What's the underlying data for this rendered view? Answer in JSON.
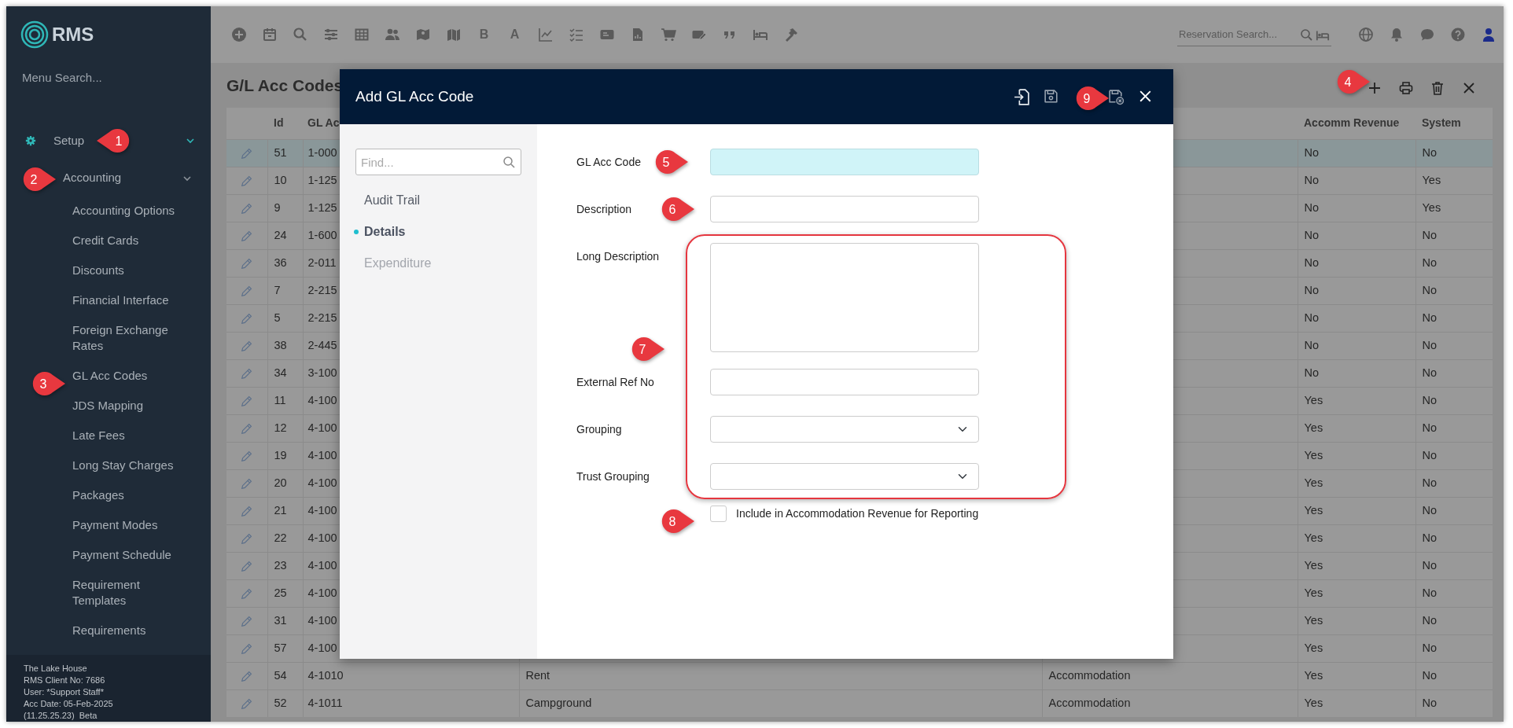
{
  "sidebar": {
    "logo": "RMS",
    "search": {
      "placeholder": "Menu Search..."
    },
    "menu": [
      {
        "label": "Setup",
        "expanded": true,
        "children": [
          {
            "label": "Accounting",
            "expanded": true,
            "children": [
              {
                "label": "Accounting Options"
              },
              {
                "label": "Credit Cards"
              },
              {
                "label": "Discounts"
              },
              {
                "label": "Financial Interface"
              },
              {
                "label": "Foreign Exchange Rates"
              },
              {
                "label": "GL Acc Codes"
              },
              {
                "label": "JDS Mapping"
              },
              {
                "label": "Late Fees"
              },
              {
                "label": "Long Stay Charges"
              },
              {
                "label": "Packages"
              },
              {
                "label": "Payment Modes"
              },
              {
                "label": "Payment Schedule"
              },
              {
                "label": "Requirement Templates"
              },
              {
                "label": "Requirements"
              }
            ]
          }
        ]
      }
    ],
    "footer": [
      "The Lake House",
      "RMS Client No: 7686",
      "User: *Support Staff*",
      "Acc Date: 05-Feb-2025",
      "(11.25.25.23)  Beta"
    ]
  },
  "top_bar": {
    "text_buttons": [
      "B",
      "A"
    ],
    "search": {
      "placeholder": "Reservation Search..."
    }
  },
  "page": {
    "title": "G/L Acc Codes"
  },
  "table": {
    "columns": {
      "id": "Id",
      "code": "GL Ac",
      "accomm_revenue": "Accomm Revenue",
      "system": "System"
    },
    "rows": [
      {
        "id": "51",
        "code": "1-000",
        "accomm_revenue": "No",
        "system": "No",
        "selected": true
      },
      {
        "id": "10",
        "code": "1-125",
        "accomm_revenue": "No",
        "system": "Yes",
        "selected": false
      },
      {
        "id": "9",
        "code": "1-125",
        "accomm_revenue": "No",
        "system": "Yes",
        "selected": false
      },
      {
        "id": "24",
        "code": "1-600",
        "accomm_revenue": "No",
        "system": "No",
        "selected": false
      },
      {
        "id": "36",
        "code": "2-011",
        "accomm_revenue": "No",
        "system": "No",
        "selected": false
      },
      {
        "id": "7",
        "code": "2-215",
        "accomm_revenue": "No",
        "system": "No",
        "selected": false
      },
      {
        "id": "5",
        "code": "2-215",
        "accomm_revenue": "No",
        "system": "No",
        "selected": false
      },
      {
        "id": "38",
        "code": "2-445",
        "accomm_revenue": "No",
        "system": "No",
        "selected": false
      },
      {
        "id": "34",
        "code": "3-100",
        "accomm_revenue": "No",
        "system": "No",
        "selected": false
      },
      {
        "id": "11",
        "code": "4-100",
        "accomm_revenue": "Yes",
        "system": "No",
        "selected": false
      },
      {
        "id": "12",
        "code": "4-100",
        "accomm_revenue": "Yes",
        "system": "No",
        "selected": false
      },
      {
        "id": "19",
        "code": "4-100",
        "accomm_revenue": "Yes",
        "system": "No",
        "selected": false
      },
      {
        "id": "20",
        "code": "4-100",
        "accomm_revenue": "Yes",
        "system": "No",
        "selected": false
      },
      {
        "id": "21",
        "code": "4-100",
        "accomm_revenue": "Yes",
        "system": "No",
        "selected": false
      },
      {
        "id": "22",
        "code": "4-100",
        "accomm_revenue": "Yes",
        "system": "No",
        "selected": false
      },
      {
        "id": "23",
        "code": "4-100",
        "accomm_revenue": "Yes",
        "system": "No",
        "selected": false
      },
      {
        "id": "25",
        "code": "4-100",
        "accomm_revenue": "Yes",
        "system": "No",
        "selected": false
      },
      {
        "id": "31",
        "code": "4-100",
        "accomm_revenue": "Yes",
        "system": "No",
        "selected": false
      },
      {
        "id": "57",
        "code": "4-100",
        "accomm_revenue": "Yes",
        "system": "No",
        "selected": false
      },
      {
        "id": "54",
        "code": "4-1010",
        "description": "Rent",
        "category": "Accommodation",
        "accomm_revenue": "Yes",
        "system": "No",
        "selected": false
      },
      {
        "id": "52",
        "code": "4-1011",
        "description": "Campground",
        "category": "Accommodation",
        "accomm_revenue": "Yes",
        "system": "No",
        "selected": false
      }
    ]
  },
  "modal": {
    "title": "Add GL Acc Code",
    "find": {
      "placeholder": "Find..."
    },
    "nav": [
      {
        "label": "Audit Trail",
        "selected": false,
        "disabled": false
      },
      {
        "label": "Details",
        "selected": true,
        "disabled": false
      },
      {
        "label": "Expenditure",
        "selected": false,
        "disabled": true
      }
    ],
    "fields": [
      {
        "kind": "text",
        "label": "GL Acc Code",
        "required": true
      },
      {
        "kind": "text",
        "label": "Description",
        "required": false
      },
      {
        "kind": "textarea",
        "label": "Long Description",
        "required": false
      },
      {
        "kind": "text",
        "label": "External Ref No",
        "required": false
      },
      {
        "kind": "select",
        "label": "Grouping",
        "required": false
      },
      {
        "kind": "select",
        "label": "Trust Grouping",
        "required": false
      },
      {
        "kind": "checkbox",
        "label": "Include in Accommodation Revenue for Reporting",
        "checked": false
      }
    ]
  },
  "annotations": {
    "highlight_frame": true,
    "callouts": [
      {
        "number": "1",
        "kind": "left"
      },
      {
        "number": "2",
        "kind": "right"
      },
      {
        "number": "3",
        "kind": "right"
      },
      {
        "number": "4",
        "kind": "right"
      },
      {
        "number": "5",
        "kind": "right"
      },
      {
        "number": "6",
        "kind": "right"
      },
      {
        "number": "7",
        "kind": "right"
      },
      {
        "number": "8",
        "kind": "right"
      },
      {
        "number": "9",
        "kind": "right"
      }
    ]
  }
}
